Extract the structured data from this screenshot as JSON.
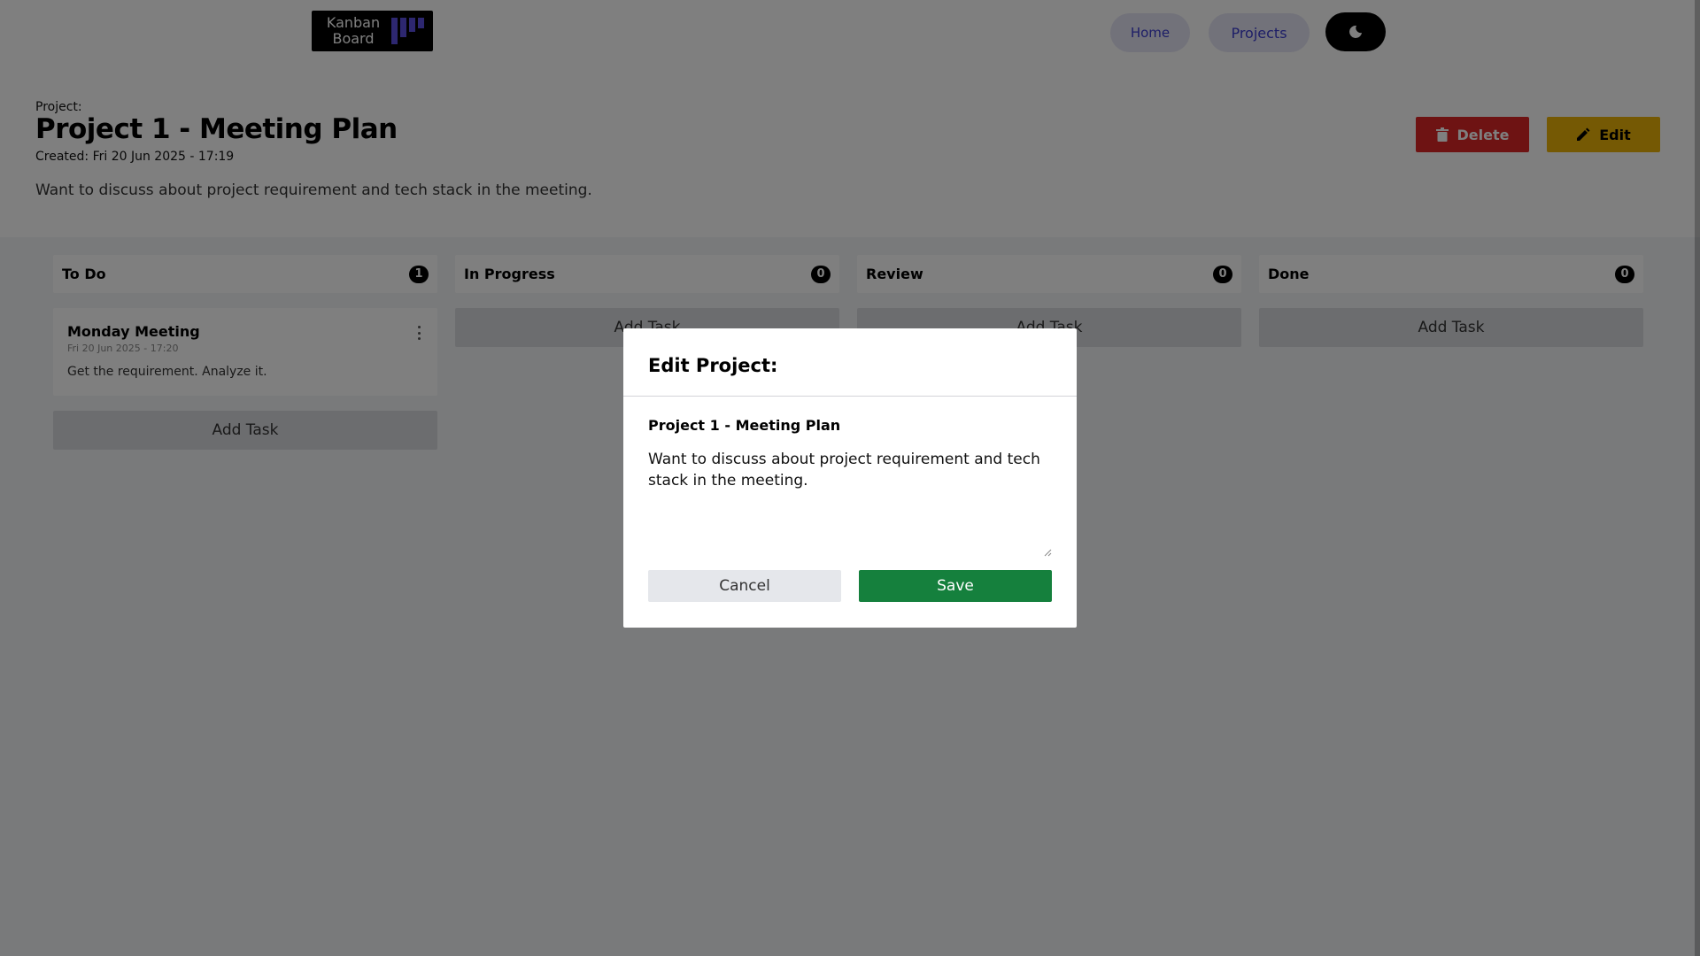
{
  "header": {
    "logo_line1": "Kanban",
    "logo_line2": "Board",
    "nav_home": "Home",
    "nav_projects": "Projects",
    "theme_icon": "moon-icon"
  },
  "project": {
    "label": "Project:",
    "title": "Project 1 - Meeting Plan",
    "created": "Created: Fri 20 Jun 2025 - 17:19",
    "description": "Want to discuss about project requirement and tech stack in the meeting.",
    "delete_label": "Delete",
    "edit_label": "Edit"
  },
  "columns": [
    {
      "title": "To Do",
      "count": "1",
      "tasks": [
        {
          "title": "Monday Meeting",
          "date": "Fri 20 Jun 2025 - 17:20",
          "description": "Get the requirement. Analyze it."
        }
      ],
      "add_label": "Add Task"
    },
    {
      "title": "In Progress",
      "count": "0",
      "tasks": [],
      "add_label": "Add Task"
    },
    {
      "title": "Review",
      "count": "0",
      "tasks": [],
      "add_label": "Add Task"
    },
    {
      "title": "Done",
      "count": "0",
      "tasks": [],
      "add_label": "Add Task"
    }
  ],
  "modal": {
    "title": "Edit Project:",
    "name_value": "Project 1 - Meeting Plan",
    "description_value": "Want to discuss about project requirement and tech stack in the meeting.",
    "cancel_label": "Cancel",
    "save_label": "Save"
  },
  "colors": {
    "delete": "#dc2626",
    "edit": "#eab308",
    "save": "#15803d",
    "nav_text": "#3b3ccf",
    "logo_accent": "#5b4fe0"
  }
}
